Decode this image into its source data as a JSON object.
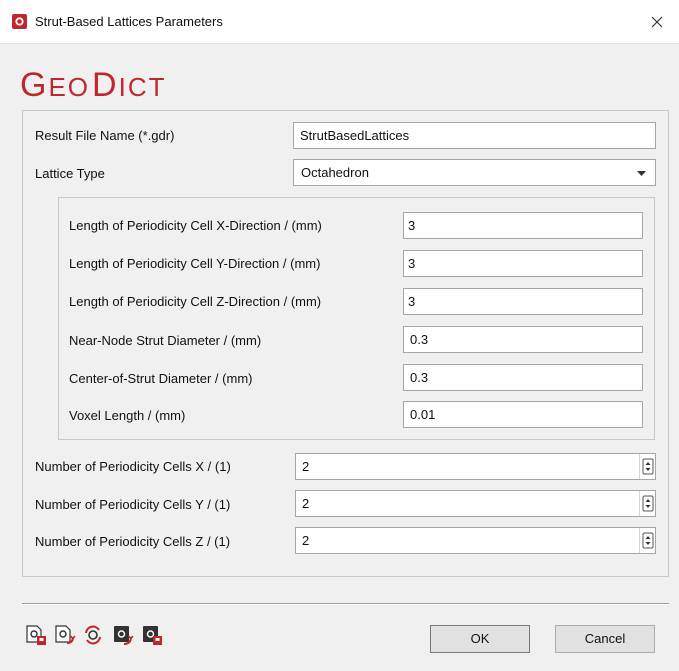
{
  "window": {
    "title": "Strut-Based Lattices Parameters"
  },
  "logo": {
    "text": "GeoDict"
  },
  "form": {
    "result_file_label": "Result File Name (*.gdr)",
    "result_file_value": "StrutBasedLattices",
    "lattice_type_label": "Lattice Type",
    "lattice_type_value": "Octahedron",
    "cell_params": [
      {
        "label": "Length of Periodicity Cell X-Direction / (mm)",
        "value": "3"
      },
      {
        "label": "Length of Periodicity Cell Y-Direction / (mm)",
        "value": "3"
      },
      {
        "label": "Length of Periodicity Cell Z-Direction / (mm)",
        "value": "3"
      },
      {
        "label": "Near-Node Strut Diameter / (mm)",
        "value": "0.3"
      },
      {
        "label": "Center-of-Strut Diameter / (mm)",
        "value": "0.3"
      },
      {
        "label": "Voxel Length / (mm)",
        "value": "0.01"
      }
    ],
    "cell_counts": [
      {
        "label": "Number of Periodicity Cells X / (1)",
        "value": "2"
      },
      {
        "label": "Number of Periodicity Cells Y / (1)",
        "value": "2"
      },
      {
        "label": "Number of Periodicity Cells Z / (1)",
        "value": "2"
      }
    ]
  },
  "toolbar": {
    "icons": [
      "load-settings-icon",
      "save-settings-icon",
      "reset-settings-icon",
      "load-macro-icon",
      "save-macro-icon"
    ]
  },
  "buttons": {
    "ok": "OK",
    "cancel": "Cancel"
  },
  "colors": {
    "accent_red": "#c0272d",
    "field_border": "#a6a6a6",
    "background": "#f0f0f0"
  }
}
